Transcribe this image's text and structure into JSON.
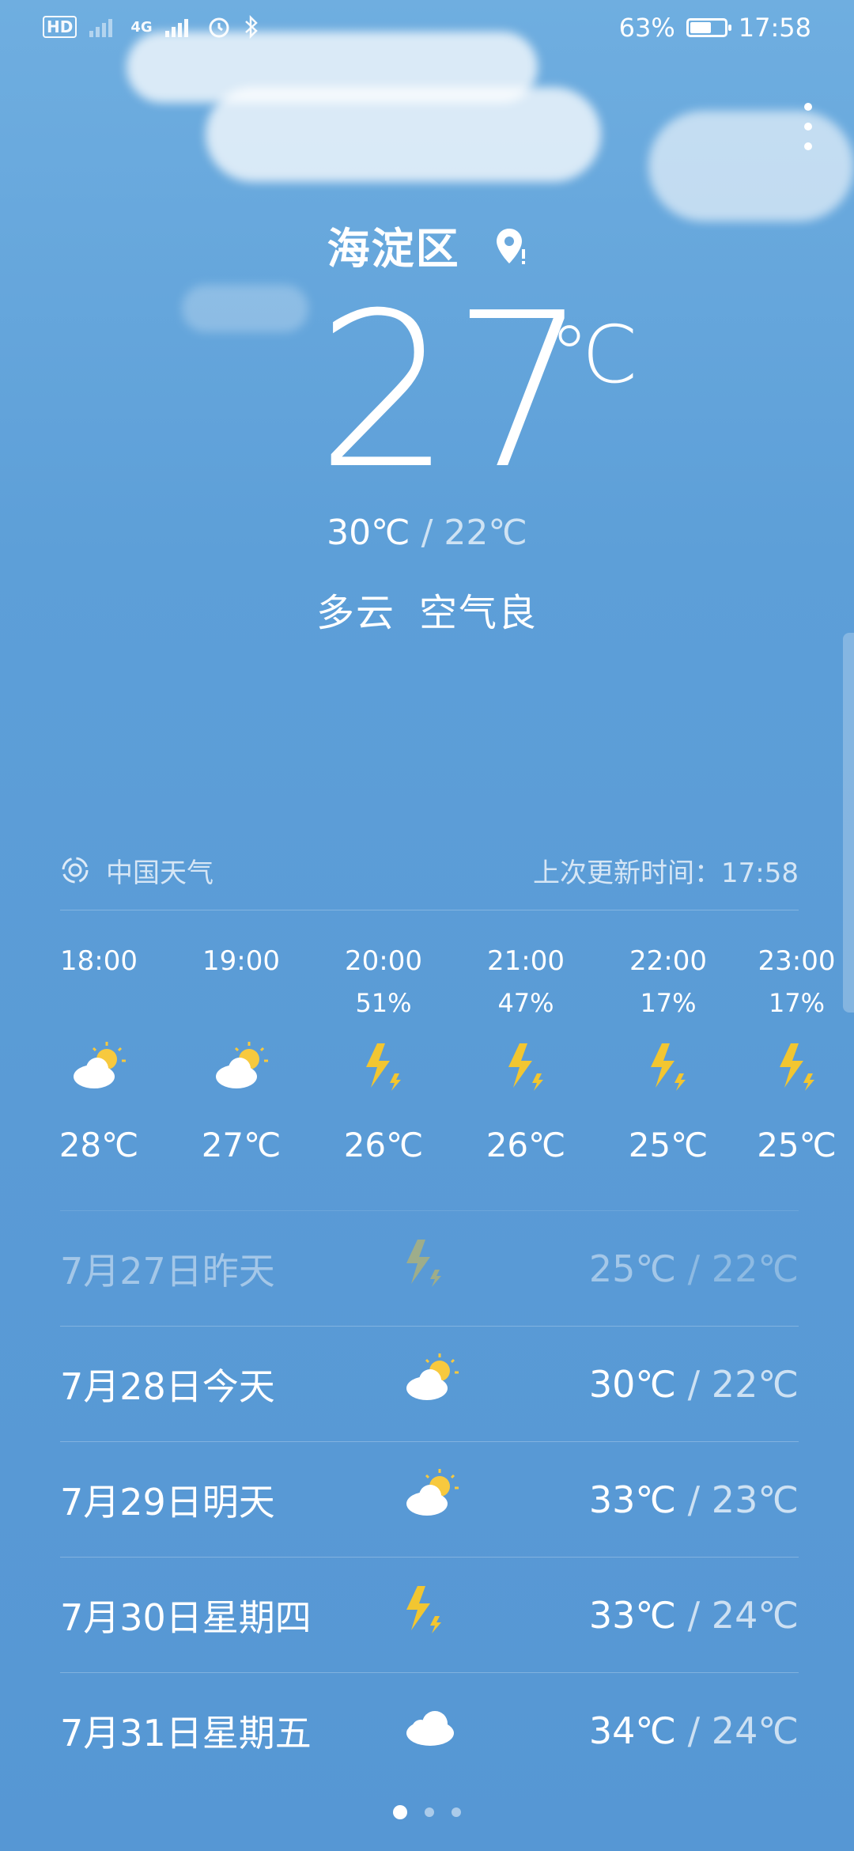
{
  "status_bar": {
    "network_labels": [
      "HD",
      "4G"
    ],
    "battery_percent": "63%",
    "battery_level": 0.63,
    "time": "17:58"
  },
  "location": {
    "name": "海淀区"
  },
  "current": {
    "temperature": "27",
    "unit": "℃",
    "high": "30℃",
    "separator": "/",
    "low": "22℃",
    "condition": "多云",
    "air_quality": "空气良"
  },
  "source": {
    "provider": "中国天气",
    "updated_label": "上次更新时间：",
    "updated_time": "17:58"
  },
  "hourly": [
    {
      "time": "18:00",
      "pop": "",
      "icon": "partly-cloudy-icon",
      "temp": "28℃"
    },
    {
      "time": "19:00",
      "pop": "",
      "icon": "partly-cloudy-icon",
      "temp": "27℃"
    },
    {
      "time": "20:00",
      "pop": "51%",
      "icon": "thunder-icon",
      "temp": "26℃"
    },
    {
      "time": "21:00",
      "pop": "47%",
      "icon": "thunder-icon",
      "temp": "26℃"
    },
    {
      "time": "22:00",
      "pop": "17%",
      "icon": "thunder-icon",
      "temp": "25℃"
    },
    {
      "time": "23:00",
      "pop": "17%",
      "icon": "thunder-icon",
      "temp": "25℃"
    }
  ],
  "daily": [
    {
      "date": "7月27日昨天",
      "icon": "thunder-icon",
      "high": "25℃",
      "sep": " / ",
      "low": "22℃"
    },
    {
      "date": "7月28日今天",
      "icon": "partly-cloudy-icon",
      "high": "30℃",
      "sep": " / ",
      "low": "22℃"
    },
    {
      "date": "7月29日明天",
      "icon": "partly-cloudy-icon",
      "high": "33℃",
      "sep": " / ",
      "low": "23℃"
    },
    {
      "date": "7月30日星期四",
      "icon": "thunder-icon",
      "high": "33℃",
      "sep": " / ",
      "low": "24℃"
    },
    {
      "date": "7月31日星期五",
      "icon": "cloudy-icon",
      "high": "34℃",
      "sep": " / ",
      "low": "24℃"
    }
  ],
  "pager": {
    "pages": 3,
    "active": 0
  },
  "colors": {
    "background": "#5d9fd8",
    "sun": "#f7c93e",
    "bolt": "#f2c631"
  }
}
